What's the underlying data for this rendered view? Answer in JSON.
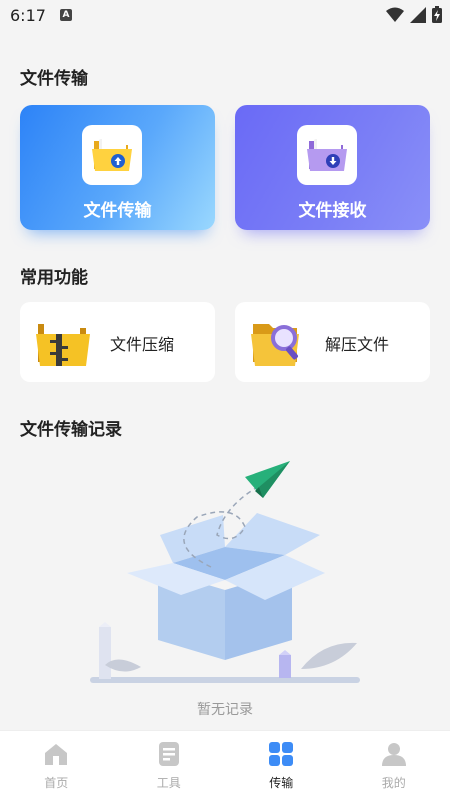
{
  "status_bar": {
    "time": "6:17",
    "icons": [
      "notification-a-icon",
      "wifi-icon",
      "signal-icon",
      "battery-charging-icon"
    ]
  },
  "sections": {
    "transfer_title": "文件传输",
    "common_title": "常用功能",
    "records_title": "文件传输记录"
  },
  "transfer_cards": [
    {
      "label": "文件传输",
      "icon": "folder-upload-icon"
    },
    {
      "label": "文件接收",
      "icon": "folder-download-icon"
    }
  ],
  "functions": [
    {
      "label": "文件压缩",
      "icon": "zip-folder-icon"
    },
    {
      "label": "解压文件",
      "icon": "unzip-folder-icon"
    }
  ],
  "empty_state": {
    "text": "暂无记录",
    "illustration": "empty-box-icon"
  },
  "tabs": [
    {
      "label": "首页",
      "icon": "home-icon",
      "active": false
    },
    {
      "label": "工具",
      "icon": "tools-icon",
      "active": false
    },
    {
      "label": "传输",
      "icon": "transfer-grid-icon",
      "active": true
    },
    {
      "label": "我的",
      "icon": "profile-icon",
      "active": false
    }
  ],
  "colors": {
    "primary": "#2d83f7",
    "receive": "#6a6af6",
    "background": "#f4f4f4",
    "accent_green": "#27b07a"
  }
}
